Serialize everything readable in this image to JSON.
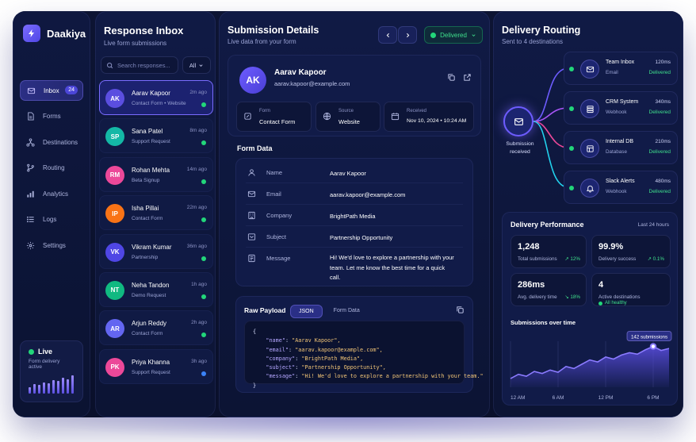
{
  "brand": {
    "name": "Daakiya"
  },
  "nav": {
    "items": [
      {
        "label": "Inbox",
        "badge": "24"
      },
      {
        "label": "Forms"
      },
      {
        "label": "Destinations"
      },
      {
        "label": "Routing"
      },
      {
        "label": "Analytics"
      },
      {
        "label": "Logs"
      },
      {
        "label": "Settings"
      }
    ],
    "live": {
      "title": "Live",
      "subtitle": "Form delivery active",
      "bars": [
        0.35,
        0.5,
        0.45,
        0.6,
        0.55,
        0.7,
        0.65,
        0.85,
        0.75,
        0.95
      ]
    }
  },
  "inbox": {
    "title": "Response Inbox",
    "subtitle": "Live form submissions",
    "search_placeholder": "Search responses...",
    "filter": "All",
    "items": [
      {
        "initials": "AK",
        "name": "Aarav Kapoor",
        "sub": "Contact Form • Website",
        "time": "2m ago",
        "color": "#5b4ee0",
        "dot": "#22d67a"
      },
      {
        "initials": "SP",
        "name": "Sana Patel",
        "sub": "Support Request",
        "time": "8m ago",
        "color": "#14b8a6",
        "dot": "#22d67a"
      },
      {
        "initials": "RM",
        "name": "Rohan Mehta",
        "sub": "Beta Signup",
        "time": "14m ago",
        "color": "#ec4899",
        "dot": "#22d67a"
      },
      {
        "initials": "IP",
        "name": "Isha Pillai",
        "sub": "Contact Form",
        "time": "22m ago",
        "color": "#f97316",
        "dot": "#22d67a"
      },
      {
        "initials": "VK",
        "name": "Vikram Kumar",
        "sub": "Partnership",
        "time": "36m ago",
        "color": "#4f46e5",
        "dot": "#22d67a"
      },
      {
        "initials": "NT",
        "name": "Neha Tandon",
        "sub": "Demo Request",
        "time": "1h ago",
        "color": "#10b981",
        "dot": "#22d67a"
      },
      {
        "initials": "AR",
        "name": "Arjun Reddy",
        "sub": "Contact Form",
        "time": "2h ago",
        "color": "#6366f1",
        "dot": "#22d67a"
      },
      {
        "initials": "PK",
        "name": "Priya Khanna",
        "sub": "Support Request",
        "time": "3h ago",
        "color": "#ec4899",
        "dot": "#3b82f6"
      }
    ]
  },
  "details": {
    "title": "Submission Details",
    "subtitle": "Live data from your form",
    "status": "Delivered",
    "contact": {
      "initials": "AK",
      "name": "Aarav Kapoor",
      "email": "aarav.kapoor@example.com"
    },
    "meta": [
      {
        "label": "Form",
        "value": "Contact Form"
      },
      {
        "label": "Source",
        "value": "Website"
      },
      {
        "label": "Received",
        "value": "Nov 10, 2024 • 10:24 AM"
      }
    ],
    "form_data_title": "Form Data",
    "fields": [
      {
        "label": "Name",
        "value": "Aarav Kapoor"
      },
      {
        "label": "Email",
        "value": "aarav.kapoor@example.com"
      },
      {
        "label": "Company",
        "value": "BrightPath Media"
      },
      {
        "label": "Subject",
        "value": "Partnership Opportunity"
      },
      {
        "label": "Message",
        "value": "Hi! We'd love to explore a partnership with your team. Let me know the best time for a quick call."
      }
    ],
    "raw": {
      "title": "Raw Payload",
      "tabs": [
        "JSON",
        "Form Data"
      ],
      "open": "{",
      "close": "}",
      "lines": [
        {
          "key": "\"name\"",
          "val": "\"Aarav Kapoor\","
        },
        {
          "key": "\"email\"",
          "val": "\"aarav.kapoor@example.com\","
        },
        {
          "key": "\"company\"",
          "val": "\"BrightPath Media\","
        },
        {
          "key": "\"subject\"",
          "val": "\"Partnership Opportunity\","
        },
        {
          "key": "\"message\"",
          "val": "\"Hi! We'd love to explore a partnership with your team.\""
        }
      ]
    }
  },
  "routing": {
    "title": "Delivery Routing",
    "subtitle": "Sent to 4 destinations",
    "hub_label": "Submission received",
    "destinations": [
      {
        "name": "Team Inbox",
        "type": "Email",
        "time": "120ms",
        "status": "Delivered",
        "color": "#6d5cff"
      },
      {
        "name": "CRM System",
        "type": "Webhook",
        "time": "340ms",
        "status": "Delivered",
        "color": "#a855f7"
      },
      {
        "name": "Internal DB",
        "type": "Database",
        "time": "210ms",
        "status": "Delivered",
        "color": "#ec4899"
      },
      {
        "name": "Slack Alerts",
        "type": "Webhook",
        "time": "480ms",
        "status": "Delivered",
        "color": "#22d3ee"
      }
    ],
    "perf": {
      "title": "Delivery Performance",
      "range": "Last 24 hours",
      "stats": [
        {
          "value": "1,248",
          "label": "Total submissions",
          "delta": "↗ 12%"
        },
        {
          "value": "99.9%",
          "label": "Delivery success",
          "delta": "↗ 0.1%"
        },
        {
          "value": "286ms",
          "label": "Avg. delivery time",
          "delta": "↘ 18%"
        },
        {
          "value": "4",
          "label": "Active destinations",
          "delta": "All healthy"
        }
      ],
      "chart_title": "Submissions over time",
      "tooltip": "142 submissions"
    }
  },
  "chart_data": {
    "type": "area",
    "title": "Submissions over time",
    "x": [
      "12 AM",
      "1 AM",
      "2 AM",
      "3 AM",
      "4 AM",
      "5 AM",
      "6 AM",
      "7 AM",
      "8 AM",
      "9 AM",
      "10 AM",
      "11 AM",
      "12 PM",
      "1 PM",
      "2 PM",
      "3 PM",
      "4 PM",
      "5 PM",
      "6 PM",
      "7 PM",
      "8 PM"
    ],
    "xticks": [
      "12 AM",
      "6 AM",
      "12 PM",
      "6 PM"
    ],
    "values": [
      30,
      45,
      38,
      55,
      48,
      60,
      52,
      72,
      65,
      80,
      95,
      88,
      105,
      98,
      112,
      120,
      115,
      130,
      142,
      128,
      135
    ],
    "ylim": [
      0,
      160
    ],
    "highlight": {
      "x": "6 PM",
      "value": 142
    },
    "colors": {
      "line": "#8b7bff",
      "fill_top": "#5b4ee0"
    }
  }
}
